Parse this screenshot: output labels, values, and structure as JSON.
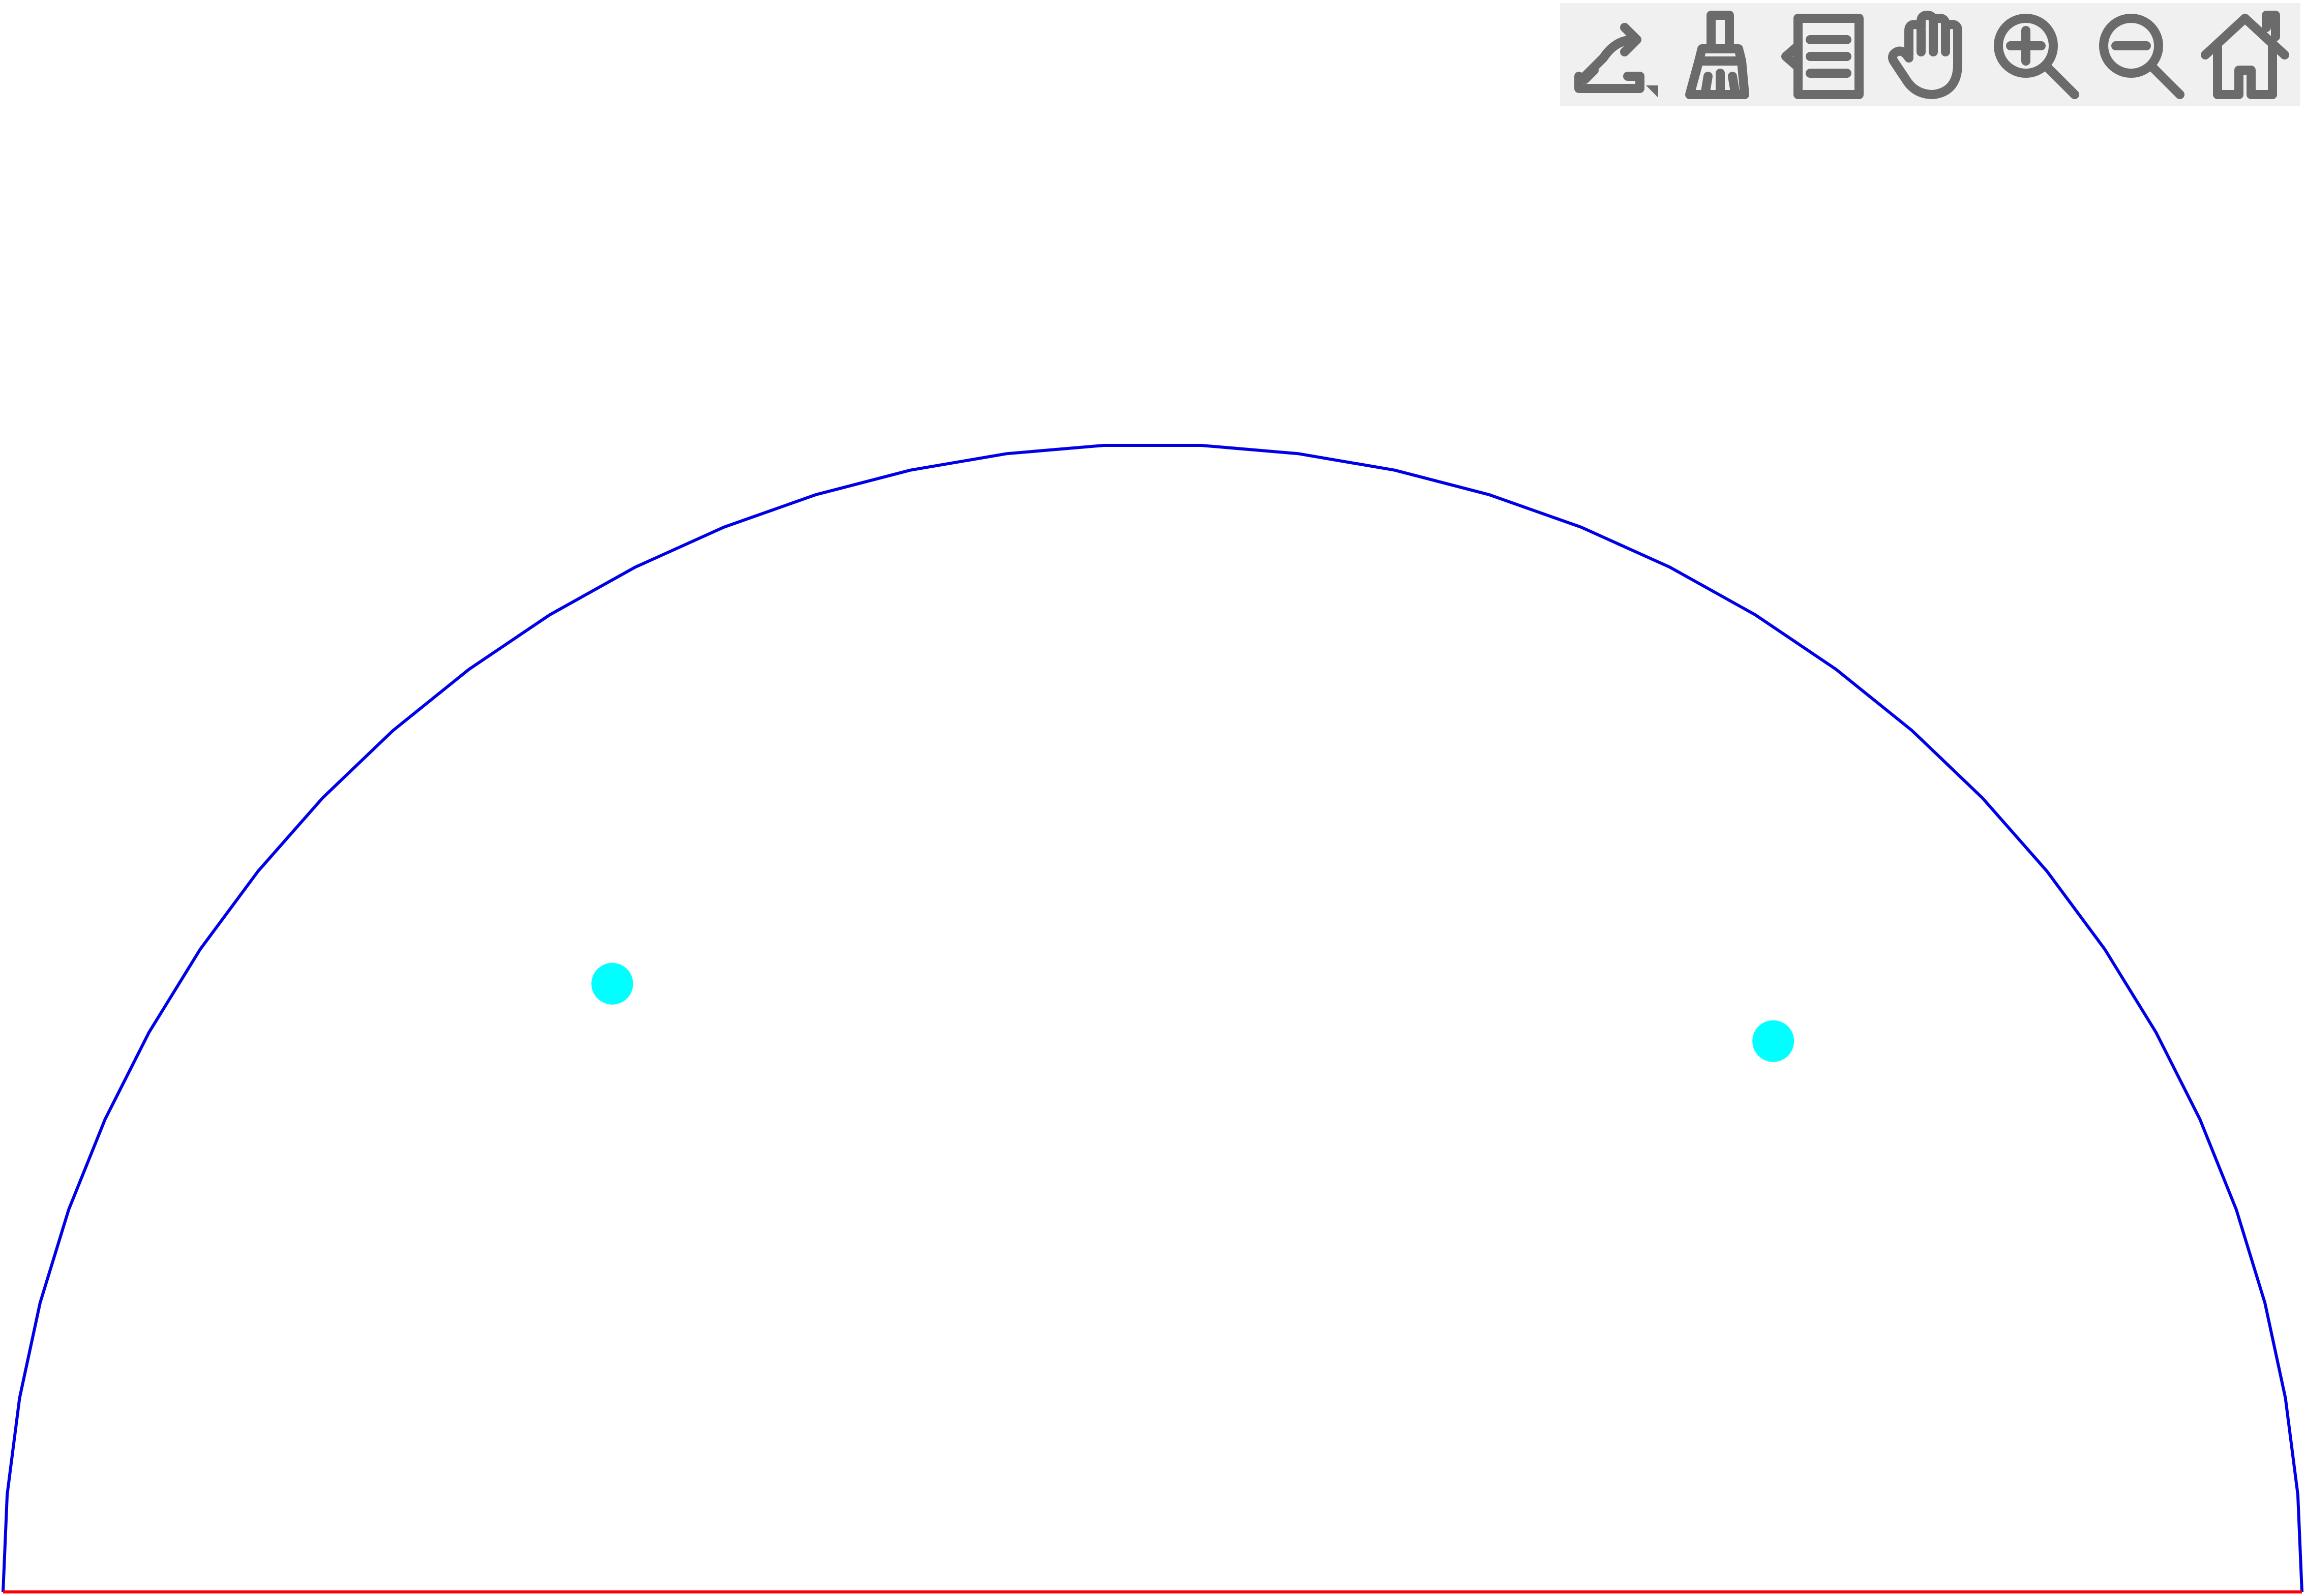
{
  "toolbar": {
    "buttons": [
      {
        "id": "export",
        "icon": "export-icon"
      },
      {
        "id": "brush",
        "icon": "brush-icon"
      },
      {
        "id": "data-list",
        "icon": "data-list-icon"
      },
      {
        "id": "pan",
        "icon": "hand-pan-icon"
      },
      {
        "id": "zoom-in",
        "icon": "zoom-in-icon"
      },
      {
        "id": "zoom-out",
        "icon": "zoom-out-icon"
      },
      {
        "id": "home",
        "icon": "home-icon"
      }
    ]
  },
  "colors": {
    "arc": "#0000e6",
    "base": "#ff0000",
    "points": "#00ffff",
    "toolbar_bg": "#f0f0f0",
    "icon": "#6b6b6b"
  },
  "chart_data": {
    "type": "scatter",
    "title": "",
    "xlabel": "",
    "ylabel": "",
    "xlim": [
      -1,
      1
    ],
    "ylim": [
      0,
      1
    ],
    "grid": false,
    "arc": {
      "shape": "semicircle",
      "radius": 1,
      "center": [
        0,
        0
      ],
      "segments": 37
    },
    "base_line": {
      "x": [
        -1,
        1
      ],
      "y": [
        0,
        0
      ]
    },
    "series": [
      {
        "points": [
          {
            "x": -0.47,
            "y": 0.53
          },
          {
            "x": 0.54,
            "y": 0.48
          }
        ]
      }
    ]
  }
}
